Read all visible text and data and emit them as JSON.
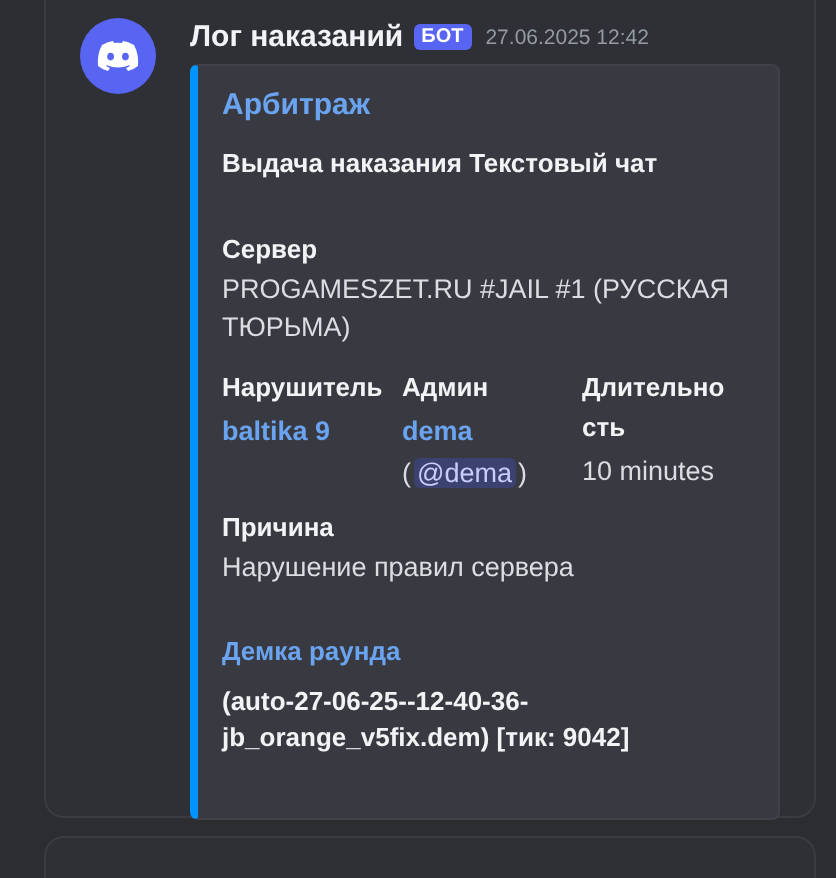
{
  "message": {
    "author": "Лог наказаний",
    "bot_tag": "БОТ",
    "timestamp": "27.06.2025 12:42",
    "embed": {
      "color": "#0094ff",
      "title": "Арбитраж",
      "description": "Выдача наказания Текстовый чат",
      "fields": [
        {
          "kind": "text",
          "inline": false,
          "name": "Сервер",
          "value": "PROGAMESZET.RU #JAIL #1 (РУССКАЯ ТЮРЬМА)"
        },
        {
          "kind": "link",
          "inline": true,
          "name": "Нарушитель",
          "value": "baltika 9"
        },
        {
          "kind": "mention",
          "inline": true,
          "name": "Админ",
          "value": "dema",
          "mention_open": "(",
          "mention": "@dema",
          "mention_close": ")"
        },
        {
          "kind": "text",
          "inline": true,
          "name": "Длительность",
          "value": "10 minutes"
        },
        {
          "kind": "text",
          "inline": false,
          "name": "Причина",
          "value": "Нарушение правил сервера"
        },
        {
          "kind": "link_title",
          "inline": false,
          "name": "Демка раунда",
          "value": "(auto-27-06-25--12-40-36-jb_orange_v5fix.dem) [тик: 9042]"
        }
      ]
    }
  }
}
